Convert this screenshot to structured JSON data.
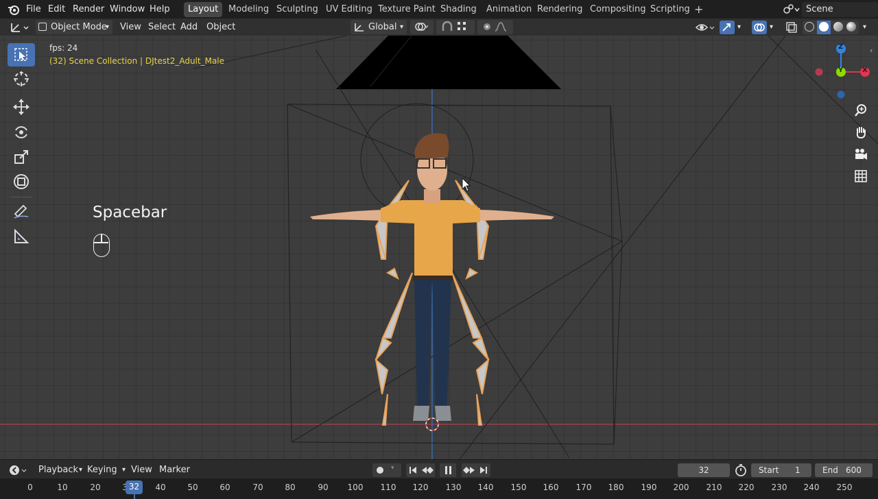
{
  "menu": {
    "file": "File",
    "edit": "Edit",
    "render": "Render",
    "window": "Window",
    "help": "Help"
  },
  "workspaces": [
    "Layout",
    "Modeling",
    "Sculpting",
    "UV Editing",
    "Texture Paint",
    "Shading",
    "Animation",
    "Rendering",
    "Compositing",
    "Scripting"
  ],
  "active_workspace": "Layout",
  "add_workspace": "+",
  "scene_name": "Scene",
  "header": {
    "mode": "Object Mode",
    "view": "View",
    "select": "Select",
    "add": "Add",
    "object": "Object",
    "orientation": "Global"
  },
  "viewport": {
    "fps": "fps: 24",
    "collection": "(32) Scene Collection | DJtest2_Adult_Male",
    "key_overlay": "Spacebar"
  },
  "gizmo": {
    "z": "Z",
    "y": "Y",
    "x": "X"
  },
  "timeline": {
    "playback": "Playback",
    "keying": "Keying",
    "view": "View",
    "marker": "Marker",
    "current_frame": "32",
    "start_label": "Start",
    "start_value": "1",
    "end_label": "End",
    "end_value": "600",
    "ticks": [
      "0",
      "10",
      "20",
      "30",
      "40",
      "50",
      "60",
      "70",
      "80",
      "90",
      "100",
      "110",
      "120",
      "130",
      "140",
      "150",
      "160",
      "170",
      "180",
      "190",
      "200",
      "210",
      "220",
      "230",
      "240",
      "250"
    ],
    "playhead_label": "32"
  },
  "colors": {
    "accent": "#4772b3",
    "x_axis": "#ff3352",
    "y_axis": "#8bdc00",
    "z_axis": "#2890ff",
    "overlay_yellow": "#e6d34a"
  }
}
